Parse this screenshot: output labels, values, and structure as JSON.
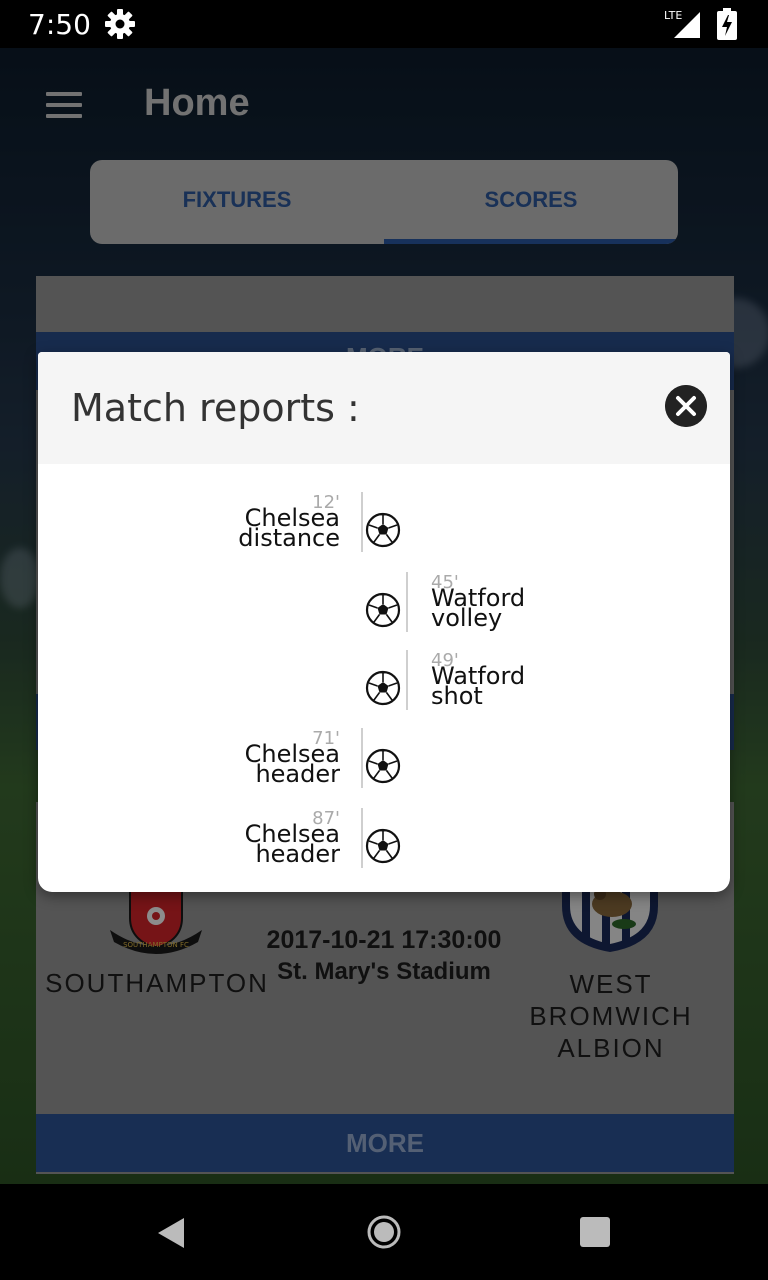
{
  "status_bar": {
    "time": "7:50",
    "network": "LTE",
    "icons": [
      "gear-icon",
      "signal-icon",
      "battery-icon"
    ]
  },
  "app": {
    "title": "Home",
    "menu_icon": "menu-icon"
  },
  "tabs": [
    {
      "label": "FIXTURES",
      "selected": false
    },
    {
      "label": "SCORES",
      "selected": true
    }
  ],
  "background_cards": {
    "more_top": "MORE",
    "match": {
      "home_team": "SOUTHAMPTON",
      "away_team": "WEST BROMWICH ALBION",
      "datetime": "2017-10-21 17:30:00",
      "venue": "St. Mary's Stadium",
      "home_crest_text": "SOUTHAMPTON FC"
    },
    "more_bottom": "MORE"
  },
  "dialog": {
    "title": "Match reports :",
    "close_icon": "close-icon",
    "events": [
      {
        "minute": "12'",
        "team": "Chelsea",
        "detail": "distance",
        "side": "left",
        "icon": "soccer-ball-icon"
      },
      {
        "minute": "45'",
        "team": "Watford",
        "detail": "volley",
        "side": "right",
        "icon": "soccer-ball-icon"
      },
      {
        "minute": "49'",
        "team": "Watford",
        "detail": "shot",
        "side": "right",
        "icon": "soccer-ball-icon"
      },
      {
        "minute": "71'",
        "team": "Chelsea",
        "detail": "header",
        "side": "left",
        "icon": "soccer-ball-icon"
      },
      {
        "minute": "87'",
        "team": "Chelsea",
        "detail": "header",
        "side": "left",
        "icon": "soccer-ball-icon"
      }
    ]
  },
  "nav_bar": {
    "icons": [
      "back-icon",
      "home-icon",
      "recent-apps-icon"
    ]
  },
  "colors": {
    "accent": "#2a59a6",
    "tab_text": "#2e5a9e",
    "dialog_bg": "#ffffff",
    "dialog_header_bg": "#f5f5f5"
  }
}
